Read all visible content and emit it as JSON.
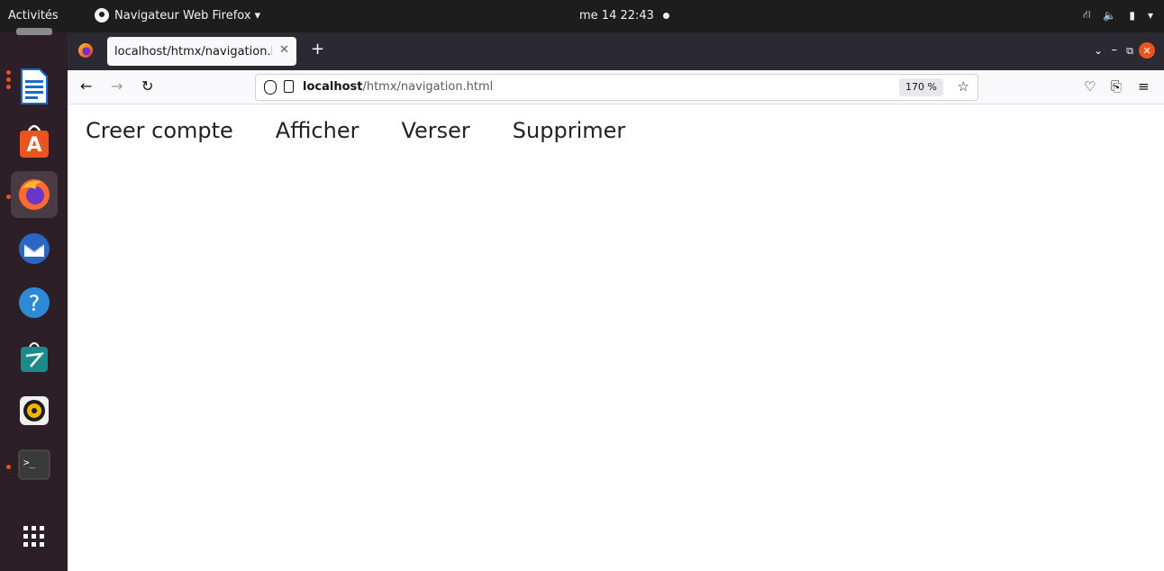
{
  "topbar": {
    "activities": "Activités",
    "app_menu": "Navigateur Web Firefox ▾",
    "clock": "me 14 22:43"
  },
  "dock": {
    "items": [
      {
        "name": "libreoffice-writer-icon"
      },
      {
        "name": "app-store-icon"
      },
      {
        "name": "firefox-icon"
      },
      {
        "name": "thunderbird-icon"
      },
      {
        "name": "help-icon"
      },
      {
        "name": "software-icon"
      },
      {
        "name": "rhythmbox-icon"
      },
      {
        "name": "terminal-icon"
      },
      {
        "name": "show-apps-icon"
      }
    ]
  },
  "browser": {
    "tab_title": "localhost/htmx/navigation.h",
    "url_host": "localhost",
    "url_path": "/htmx/navigation.html",
    "zoom": "170 %",
    "accent": "#e95420"
  },
  "page": {
    "links": [
      "Creer compte",
      "Afficher",
      "Verser",
      "Supprimer"
    ]
  }
}
